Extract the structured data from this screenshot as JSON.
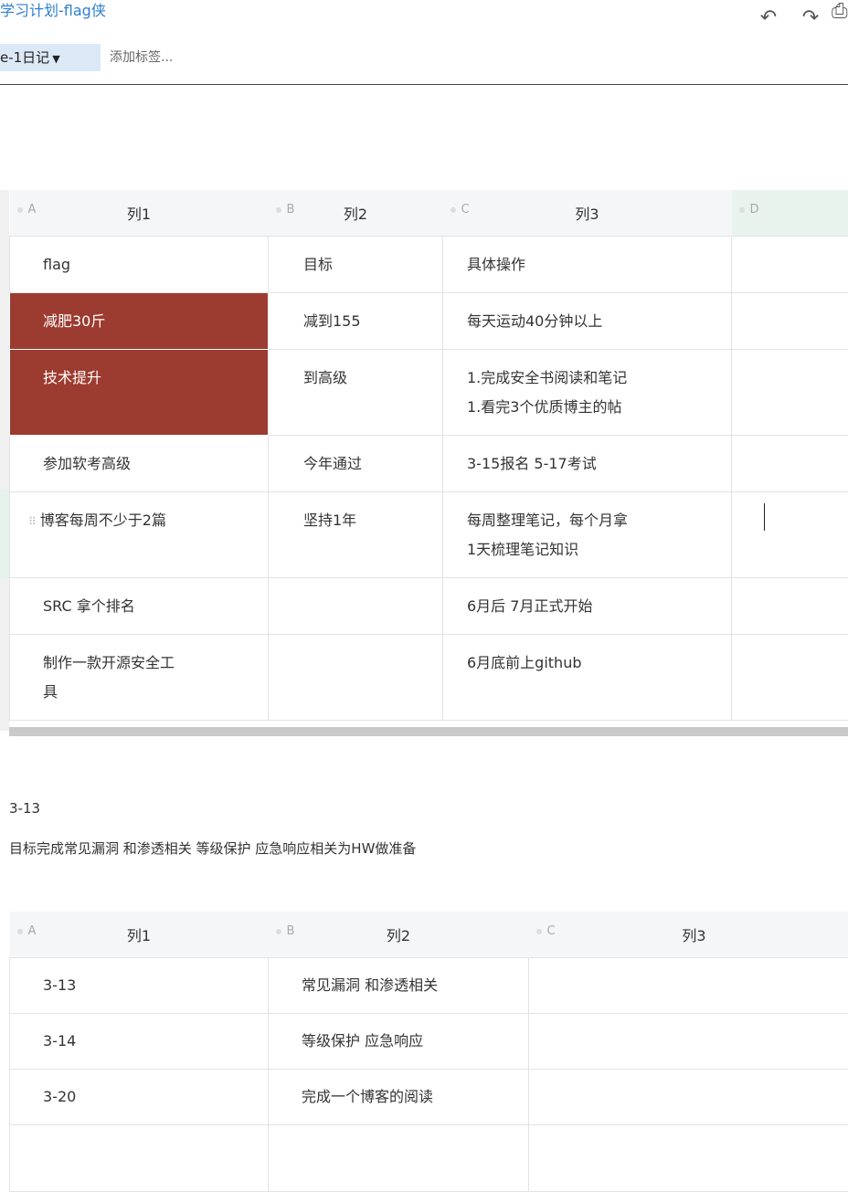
{
  "header": {
    "title": "学习计划-flag侠",
    "undo_icon": "undo-icon",
    "redo_icon": "redo-icon"
  },
  "tagbar": {
    "notebook": "e-1日记",
    "add_tag": "添加标签..."
  },
  "table1": {
    "columns": [
      {
        "letter": "A",
        "label": "列1"
      },
      {
        "letter": "B",
        "label": "列2"
      },
      {
        "letter": "C",
        "label": "列3"
      },
      {
        "letter": "D",
        "label": ""
      }
    ],
    "rows": [
      [
        "flag",
        "目标",
        "具体操作",
        ""
      ],
      [
        "减肥30斤",
        "减到155",
        "每天运动40分钟以上",
        ""
      ],
      [
        "技术提升",
        "到高级",
        "1.完成安全书阅读和笔记\n1.看完3个优质博主的帖",
        ""
      ],
      [
        "参加软考高级",
        "今年通过",
        "3-15报名 5-17考试",
        ""
      ],
      [
        "博客每周不少于2篇",
        "坚持1年",
        "每周整理笔记，每个月拿\n1天梳理笔记知识",
        ""
      ],
      [
        "SRC 拿个排名",
        "",
        "6月后 7月正式开始",
        ""
      ],
      [
        "制作一款开源安全工\n具",
        "",
        "6月底前上github",
        ""
      ]
    ],
    "highlight_color": "#9c3b2f"
  },
  "text": {
    "date": "3-13",
    "goal": "目标完成常见漏洞 和渗透相关 等级保护 应急响应相关为HW做准备"
  },
  "table2": {
    "columns": [
      {
        "letter": "A",
        "label": "列1"
      },
      {
        "letter": "B",
        "label": "列2"
      },
      {
        "letter": "C",
        "label": "列3"
      }
    ],
    "rows": [
      [
        "3-13",
        "常见漏洞 和渗透相关",
        ""
      ],
      [
        "3-14",
        "等级保护 应急响应",
        ""
      ],
      [
        "3-20",
        "完成一个博客的阅读",
        ""
      ],
      [
        "",
        "",
        ""
      ]
    ]
  }
}
